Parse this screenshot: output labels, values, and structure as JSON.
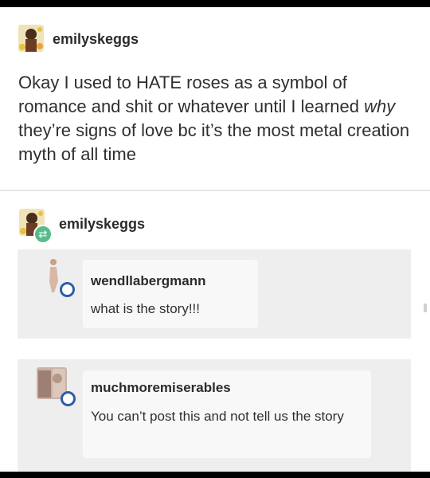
{
  "post": {
    "author": "emilyskeggs",
    "body_before": "Okay I used to HATE roses as a symbol of romance and shit or whatever until I learned ",
    "body_emph": "why",
    "body_after": " they’re signs of love bc it’s the most metal creation myth of all time"
  },
  "reblog": {
    "author": "emilyskeggs"
  },
  "replies": [
    {
      "user": "wendllabergmann",
      "text": "what is the story!!!"
    },
    {
      "user": "muchmoremiserables",
      "text": "You can’t post this and not tell us the story"
    }
  ],
  "colors": {
    "reblog_badge": "#56bc8a",
    "follow_ring": "#2c5fa6",
    "reply_bg": "#eeeeee"
  },
  "icons": {
    "reblog": "reblog-arrows-icon",
    "follow": "follow-ring-icon"
  }
}
